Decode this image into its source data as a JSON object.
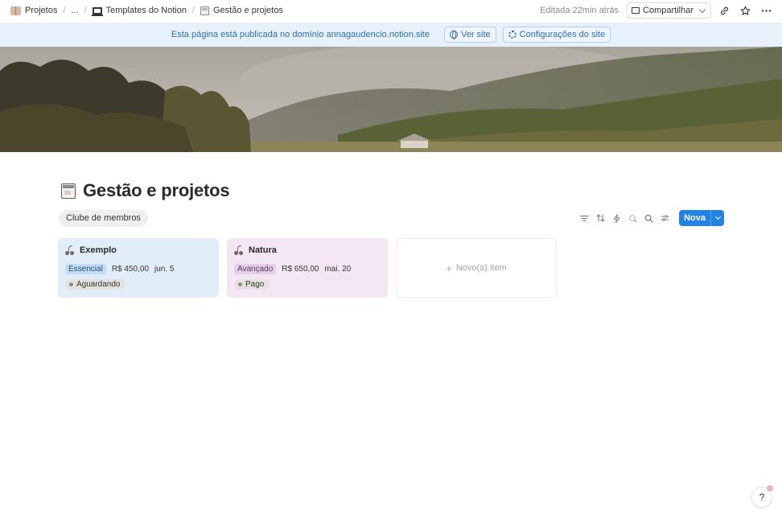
{
  "breadcrumb": {
    "items": [
      {
        "label": "Projetos",
        "icon": "book-icon"
      },
      {
        "label": "...",
        "icon": ""
      },
      {
        "label": "Templates do Notion",
        "icon": "laptop-icon"
      },
      {
        "label": "Gestão e projetos",
        "icon": "page-icon"
      }
    ],
    "separator": "/"
  },
  "topbar": {
    "edited": "Editada 22min atrás",
    "share_label": "Compartilhar"
  },
  "banner": {
    "text": "Esta página está publicada no domínio annagaudencio.notion.site",
    "view_site": "Ver site",
    "site_settings": "Configurações do site",
    "color": "#2e6fb0"
  },
  "page": {
    "title": "Gestão e projetos"
  },
  "view": {
    "tab_label": "Clube de membros",
    "new_button": "Nova",
    "accent": "#2383e2"
  },
  "cards": [
    {
      "title": "Exemplo",
      "tag": "Essencial",
      "price": "R$ 450,00",
      "date": "jun. 5",
      "status": "Aguardando",
      "color": "#e2edfa"
    },
    {
      "title": "Natura",
      "tag": "Avançado",
      "price": "R$ 650,00",
      "date": "mai. 20",
      "status": "Pago",
      "color": "#f4e6f3"
    }
  ],
  "new_item": {
    "plus": "+",
    "label": "Novo(a) item"
  },
  "help": {
    "label": "?"
  }
}
